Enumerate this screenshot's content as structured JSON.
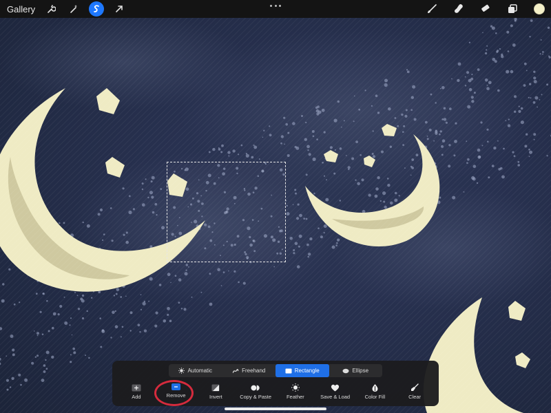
{
  "topbar": {
    "gallery_label": "Gallery",
    "left_tools": [
      "wrench-icon",
      "magic-wand-icon",
      "selection-icon",
      "transform-arrow-icon"
    ],
    "active_tool": "selection-icon",
    "right_tools": [
      "brush-icon",
      "smudge-icon",
      "eraser-icon",
      "layers-icon"
    ],
    "current_color": "#f4f0c8"
  },
  "selection_modes": [
    {
      "label": "Automatic",
      "icon": "automatic-icon",
      "active": false
    },
    {
      "label": "Freehand",
      "icon": "freehand-icon",
      "active": false
    },
    {
      "label": "Rectangle",
      "icon": "rectangle-icon",
      "active": true
    },
    {
      "label": "Ellipse",
      "icon": "ellipse-icon",
      "active": false
    }
  ],
  "selection_actions": [
    {
      "label": "Add",
      "icon": "add-icon"
    },
    {
      "label": "Remove",
      "icon": "remove-icon",
      "highlighted": true
    },
    {
      "label": "Invert",
      "icon": "invert-icon"
    },
    {
      "label": "Copy & Paste",
      "icon": "copy-paste-icon"
    },
    {
      "label": "Feather",
      "icon": "feather-icon"
    },
    {
      "label": "Save & Load",
      "icon": "save-load-icon"
    },
    {
      "label": "Color Fill",
      "icon": "color-fill-icon"
    },
    {
      "label": "Clear",
      "icon": "clear-icon"
    }
  ],
  "colors": {
    "accent": "#1f6fe6",
    "annotation_circle": "#d52b3d",
    "moon": "#efebc4",
    "moon_shadow": "#cfc9a0",
    "sky": "#283150"
  }
}
